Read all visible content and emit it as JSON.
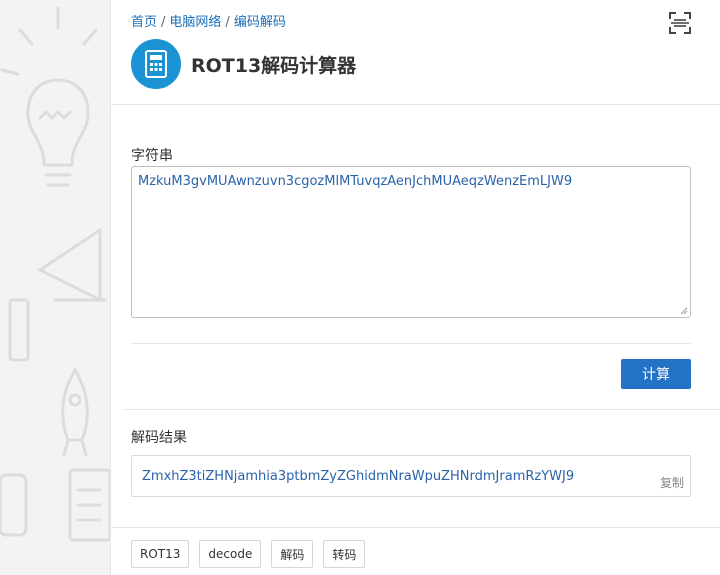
{
  "breadcrumb": {
    "home": "首页",
    "category": "电脑网络",
    "subcategory": "编码解码",
    "separator": "/"
  },
  "header": {
    "title": "ROT13解码计算器",
    "icon": "calculator-icon",
    "accent_color": "#1a92d4"
  },
  "input": {
    "label": "字符串",
    "value": "MzkuM3gvMUAwnzuvn3cgozMlMTuvqzAenJchMUAeqzWenzEmLJW9"
  },
  "actions": {
    "calculate_label": "计算",
    "button_color": "#2272c6"
  },
  "result": {
    "label": "解码结果",
    "value": "ZmxhZ3tiZHNjamhia3ptbmZyZGhidmNraWpuZHNrdmJramRzYWJ9",
    "copy_label": "复制"
  },
  "tags": [
    "ROT13",
    "decode",
    "解码",
    "转码"
  ]
}
